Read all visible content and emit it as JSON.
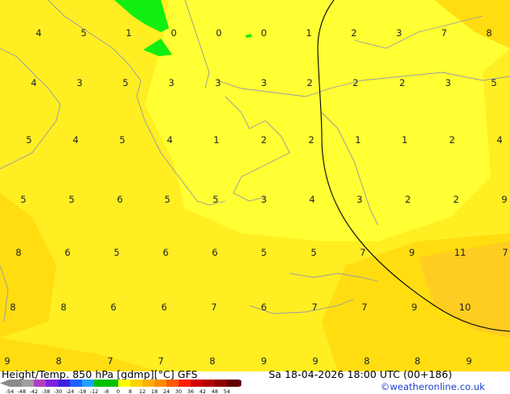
{
  "map": {
    "labels": [
      {
        "text": "4",
        "col": 1,
        "row": 0
      },
      {
        "text": "5",
        "col": 2,
        "row": 0
      },
      {
        "text": "1",
        "col": 3,
        "row": 0
      },
      {
        "text": "0",
        "col": 4,
        "row": 0
      },
      {
        "text": "0",
        "col": 5,
        "row": 0
      },
      {
        "text": "0",
        "col": 6,
        "row": 0
      },
      {
        "text": "1",
        "col": 7,
        "row": 0
      },
      {
        "text": "2",
        "col": 8,
        "row": 0
      },
      {
        "text": "3",
        "col": 9,
        "row": 0
      },
      {
        "text": "7",
        "col": 10,
        "row": 0
      },
      {
        "text": "8",
        "col": 11,
        "row": 0
      },
      {
        "text": "4",
        "col": 1,
        "row": 1
      },
      {
        "text": "3",
        "col": 2,
        "row": 1
      },
      {
        "text": "5",
        "col": 3,
        "row": 1
      },
      {
        "text": "3",
        "col": 4,
        "row": 1
      },
      {
        "text": "3",
        "col": 5,
        "row": 1
      },
      {
        "text": "3",
        "col": 6,
        "row": 1
      },
      {
        "text": "2",
        "col": 7,
        "row": 1
      },
      {
        "text": "2",
        "col": 8,
        "row": 1
      },
      {
        "text": "2",
        "col": 9,
        "row": 1
      },
      {
        "text": "3",
        "col": 10,
        "row": 1
      },
      {
        "text": "5",
        "col": 11,
        "row": 1
      },
      {
        "text": "5",
        "col": 0,
        "row": 2
      },
      {
        "text": "4",
        "col": 1,
        "row": 2
      },
      {
        "text": "5",
        "col": 2,
        "row": 2
      },
      {
        "text": "4",
        "col": 3,
        "row": 2
      },
      {
        "text": "1",
        "col": 4,
        "row": 2
      },
      {
        "text": "2",
        "col": 5,
        "row": 2
      },
      {
        "text": "2",
        "col": 6,
        "row": 2
      },
      {
        "text": "1",
        "col": 7,
        "row": 2
      },
      {
        "text": "1",
        "col": 8,
        "row": 2
      },
      {
        "text": "2",
        "col": 9,
        "row": 2
      },
      {
        "text": "4",
        "col": 10,
        "row": 2
      },
      {
        "text": "5",
        "col": 0,
        "row": 3
      },
      {
        "text": "5",
        "col": 1,
        "row": 3
      },
      {
        "text": "6",
        "col": 2,
        "row": 3
      },
      {
        "text": "5",
        "col": 3,
        "row": 3
      },
      {
        "text": "5",
        "col": 4,
        "row": 3
      },
      {
        "text": "3",
        "col": 5,
        "row": 3
      },
      {
        "text": "4",
        "col": 6,
        "row": 3
      },
      {
        "text": "3",
        "col": 7,
        "row": 3
      },
      {
        "text": "2",
        "col": 8,
        "row": 3
      },
      {
        "text": "2",
        "col": 9,
        "row": 3
      },
      {
        "text": "9",
        "col": 10,
        "row": 3
      },
      {
        "text": "8",
        "col": 0,
        "row": 4
      },
      {
        "text": "6",
        "col": 1,
        "row": 4
      },
      {
        "text": "5",
        "col": 2,
        "row": 4
      },
      {
        "text": "6",
        "col": 3,
        "row": 4
      },
      {
        "text": "6",
        "col": 4,
        "row": 4
      },
      {
        "text": "5",
        "col": 5,
        "row": 4
      },
      {
        "text": "5",
        "col": 6,
        "row": 4
      },
      {
        "text": "7",
        "col": 7,
        "row": 4
      },
      {
        "text": "9",
        "col": 8,
        "row": 4
      },
      {
        "text": "11",
        "col": 9,
        "row": 4
      },
      {
        "text": "7",
        "col": 10,
        "row": 4
      },
      {
        "text": "8",
        "col": 0,
        "row": 5
      },
      {
        "text": "8",
        "col": 1,
        "row": 5
      },
      {
        "text": "6",
        "col": 2,
        "row": 5
      },
      {
        "text": "6",
        "col": 3,
        "row": 5
      },
      {
        "text": "7",
        "col": 4,
        "row": 5
      },
      {
        "text": "6",
        "col": 5,
        "row": 5
      },
      {
        "text": "7",
        "col": 6,
        "row": 5
      },
      {
        "text": "7",
        "col": 7,
        "row": 5
      },
      {
        "text": "9",
        "col": 8,
        "row": 5
      },
      {
        "text": "10",
        "col": 9,
        "row": 5
      },
      {
        "text": "9",
        "col": 0,
        "row": 6
      },
      {
        "text": "8",
        "col": 1,
        "row": 6
      },
      {
        "text": "7",
        "col": 2,
        "row": 6
      },
      {
        "text": "7",
        "col": 3,
        "row": 6
      },
      {
        "text": "8",
        "col": 4,
        "row": 6
      },
      {
        "text": "9",
        "col": 5,
        "row": 6
      },
      {
        "text": "9",
        "col": 6,
        "row": 6
      },
      {
        "text": "8",
        "col": 7,
        "row": 6
      },
      {
        "text": "8",
        "col": 8,
        "row": 6
      },
      {
        "text": "9",
        "col": 9,
        "row": 6
      }
    ],
    "colors": {
      "cold_yellow": "#ffff33",
      "mid_yellow": "#ffee22",
      "warm_yellow": "#ffdd11",
      "orange": "#ffcc22",
      "green": "#11ee11",
      "coast": "#9999aa",
      "terminator": "#000000"
    }
  },
  "footer": {
    "title": "Height/Temp. 850 hPa [gdmp][°C] GFS",
    "datetime": "Sa 18-04-2026 18:00 UTC (00+186)",
    "credit": "©weatheronline.co.uk",
    "scale_ticks": [
      "-54",
      "-48",
      "-42",
      "-38",
      "-30",
      "-24",
      "-18",
      "-12",
      "-8",
      "0",
      "8",
      "12",
      "18",
      "24",
      "30",
      "36",
      "42",
      "48",
      "54"
    ],
    "scale_colors": [
      "#8a8a8a",
      "#a0a0a0",
      "#b040c0",
      "#8020e0",
      "#4020e0",
      "#2060ff",
      "#20a0ff",
      "#00c000",
      "#00c000",
      "#ffff00",
      "#ffd200",
      "#ffb000",
      "#ff8c00",
      "#ff5a00",
      "#ff1e00",
      "#d20000",
      "#b40000",
      "#8c0000",
      "#600000"
    ]
  }
}
